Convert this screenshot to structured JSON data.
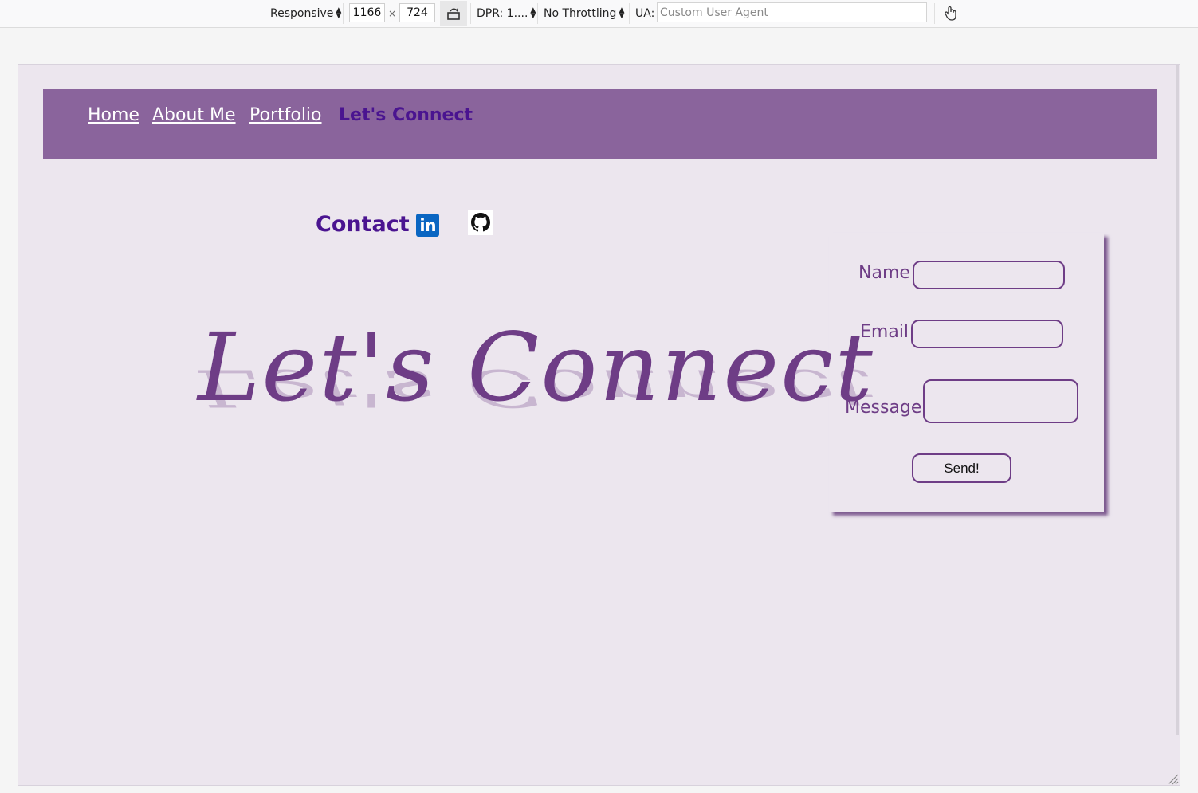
{
  "devtools": {
    "device": "Responsive",
    "width": "1166",
    "times": "×",
    "height": "724",
    "dpr": "DPR: 1....",
    "throttling": "No Throttling",
    "ua_label": "UA:",
    "ua_placeholder": "Custom User Agent"
  },
  "site": {
    "nav": [
      {
        "label": "Home"
      },
      {
        "label": "About Me"
      },
      {
        "label": "Portfolio"
      },
      {
        "label": "Let's Connect"
      }
    ],
    "contact_title": "Contact",
    "linkedin_text": "in",
    "hero_script": "Let's Connect",
    "form": {
      "name_label": "Name",
      "email_label": "Email",
      "message_label": "Message",
      "send_label": "Send!"
    }
  },
  "colors": {
    "nav_bg": "#8a649c",
    "accent": "#4a1490",
    "script": "#6e3d86",
    "page_bg": "#ece6ee"
  }
}
